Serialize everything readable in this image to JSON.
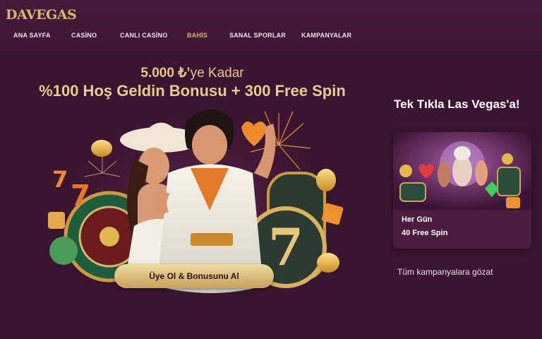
{
  "brand": {
    "logo_text": "DAVEGAS"
  },
  "nav": {
    "items": [
      {
        "label": "ANA SAYFA"
      },
      {
        "label": "CASİNO"
      },
      {
        "label": "CANLI CASİNO"
      },
      {
        "label": "BAHİS"
      },
      {
        "label": "SANAL SPORLAR"
      },
      {
        "label": "KAMPANYALAR"
      }
    ],
    "active_index": 3
  },
  "hero": {
    "line1_amount": "5.000 ₺’",
    "line1_rest": "ye Kadar",
    "line2": "%100 Hoş Geldin Bonusu + 300 Free Spin",
    "cta_label": "Üye Ol & Bonusunu Al"
  },
  "sidebar": {
    "title": "Tek Tıkla Las Vegas'a!",
    "promo": {
      "subtitle": "Her Gün",
      "title": "40 Free Spin"
    },
    "all_campaigns_label": "Tüm kampanyalara gözat"
  },
  "colors": {
    "background": "#3a1430",
    "gold": "#e3c88a",
    "card": "#4b1c40",
    "active_nav": "#d6b46c"
  },
  "icons": [
    "logo",
    "coin-icon",
    "heart-icon",
    "dice-icon",
    "seven-icon",
    "firework-icon"
  ]
}
